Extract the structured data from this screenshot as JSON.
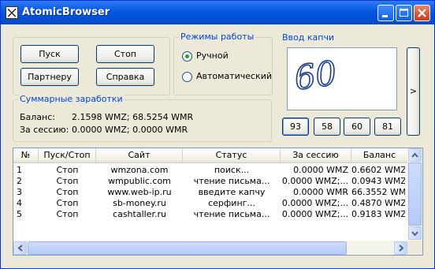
{
  "window": {
    "title": "AtomicBrowser"
  },
  "controls": {
    "start_label": "Пуск",
    "stop_label": "Стоп",
    "partner_label": "Партнеру",
    "help_label": "Справка"
  },
  "modes": {
    "title": "Режимы работы",
    "manual_label": "Ручной",
    "auto_label": "Автоматический",
    "selected": "Ручной"
  },
  "earnings": {
    "title": "Суммарные заработки",
    "balance_label": "Баланс:",
    "balance_value": "2.1598 WMZ; 68.5254 WMR",
    "session_label": "За сессию:",
    "session_value": "0.0000 WMZ; 0.0000 WMR"
  },
  "captcha": {
    "title": "Ввод капчи",
    "image_text": "60",
    "next_label": ">",
    "options": [
      "93",
      "58",
      "60",
      "81"
    ]
  },
  "table": {
    "columns": [
      "№",
      "Пуск/Стоп",
      "Сайт",
      "Статус",
      "За сессию",
      "Баланс"
    ],
    "rows": [
      [
        "1",
        "Стоп",
        "wmzona.com",
        "поиск...",
        "0.0000 WMZ",
        "0.6602 WMZ"
      ],
      [
        "2",
        "Стоп",
        "wmpublic.com",
        "чтение письма...",
        "0.0000 WMZ;...",
        "0.0943 WMZ;..."
      ],
      [
        "3",
        "Стоп",
        "www.web-ip.ru",
        "введите капчу",
        "0.0000 WMR",
        "66.3552 WMR"
      ],
      [
        "4",
        "Стоп",
        "sb-money.ru",
        "серфинг...",
        "0.0000 WMZ;...",
        "0.4870 WMZ;..."
      ],
      [
        "5",
        "Стоп",
        "cashtaller.ru",
        "чтение письма...",
        "0.0000 WMZ;...",
        "0.9183 WMZ;..."
      ]
    ]
  },
  "colors": {
    "titlebar": "#0a5be0",
    "group_title": "#0046d5",
    "window_bg": "#ece9d8"
  }
}
